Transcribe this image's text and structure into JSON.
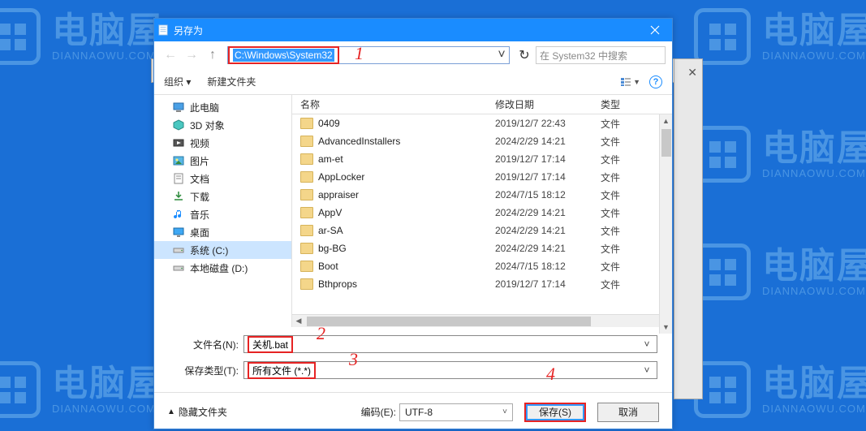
{
  "watermark": {
    "brand": "电脑屋",
    "domain": "DIANNAOWU.COM"
  },
  "dialog": {
    "title": "另存为",
    "address": "C:\\Windows\\System32",
    "search_placeholder": "在 System32 中搜索",
    "toolbar": {
      "organize": "组织",
      "newfolder": "新建文件夹"
    },
    "tree": [
      {
        "label": "此电脑",
        "icon": "pc"
      },
      {
        "label": "3D 对象",
        "icon": "3d"
      },
      {
        "label": "视频",
        "icon": "video"
      },
      {
        "label": "图片",
        "icon": "pic"
      },
      {
        "label": "文档",
        "icon": "doc"
      },
      {
        "label": "下载",
        "icon": "dl"
      },
      {
        "label": "音乐",
        "icon": "music"
      },
      {
        "label": "桌面",
        "icon": "desk"
      },
      {
        "label": "系统 (C:)",
        "icon": "drive",
        "selected": true
      },
      {
        "label": "本地磁盘 (D:)",
        "icon": "drive"
      }
    ],
    "columns": {
      "name": "名称",
      "date": "修改日期",
      "type": "类型"
    },
    "files": [
      {
        "name": "0409",
        "date": "2019/12/7 22:43",
        "type": "文件"
      },
      {
        "name": "AdvancedInstallers",
        "date": "2024/2/29 14:21",
        "type": "文件"
      },
      {
        "name": "am-et",
        "date": "2019/12/7 17:14",
        "type": "文件"
      },
      {
        "name": "AppLocker",
        "date": "2019/12/7 17:14",
        "type": "文件"
      },
      {
        "name": "appraiser",
        "date": "2024/7/15 18:12",
        "type": "文件"
      },
      {
        "name": "AppV",
        "date": "2024/2/29 14:21",
        "type": "文件"
      },
      {
        "name": "ar-SA",
        "date": "2024/2/29 14:21",
        "type": "文件"
      },
      {
        "name": "bg-BG",
        "date": "2024/2/29 14:21",
        "type": "文件"
      },
      {
        "name": "Boot",
        "date": "2024/7/15 18:12",
        "type": "文件"
      },
      {
        "name": "Bthprops",
        "date": "2019/12/7 17:14",
        "type": "文件"
      }
    ],
    "filename_label": "文件名(N):",
    "filename_value": "关机.bat",
    "filetype_label": "保存类型(T):",
    "filetype_value": "所有文件 (*.*)",
    "hide_folders": "隐藏文件夹",
    "encoding_label": "编码(E):",
    "encoding_value": "UTF-8",
    "save": "保存(S)",
    "cancel": "取消"
  },
  "annotations": {
    "n1": "1",
    "n2": "2",
    "n3": "3",
    "n4": "4"
  }
}
